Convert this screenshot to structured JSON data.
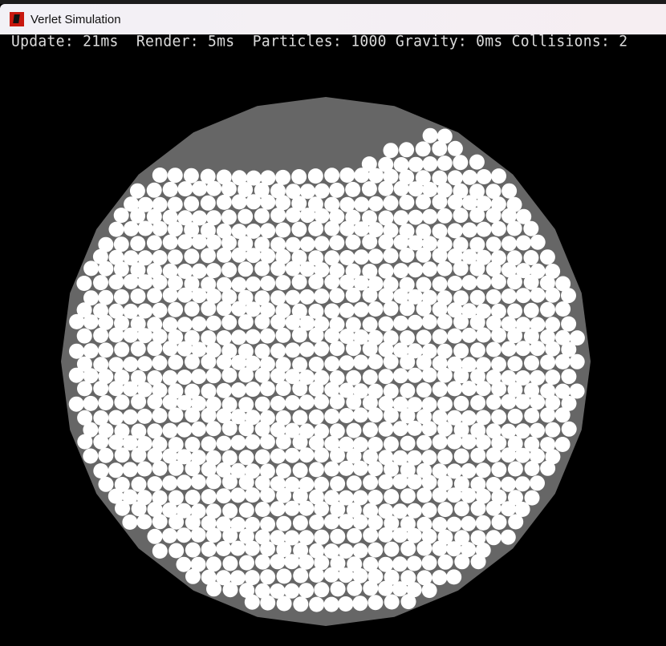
{
  "window": {
    "title": "Verlet Simulation",
    "icon": "app-icon"
  },
  "stats": {
    "text": "Update: 21ms  Render: 5ms  Particles: 1000 Gravity: 0ms Collisions: 2"
  },
  "colors": {
    "background": "#000000",
    "container": "#666666",
    "particle": "#ffffff",
    "stats_text": "#dcdcdc"
  },
  "simulation": {
    "particle_count": 1000
  }
}
